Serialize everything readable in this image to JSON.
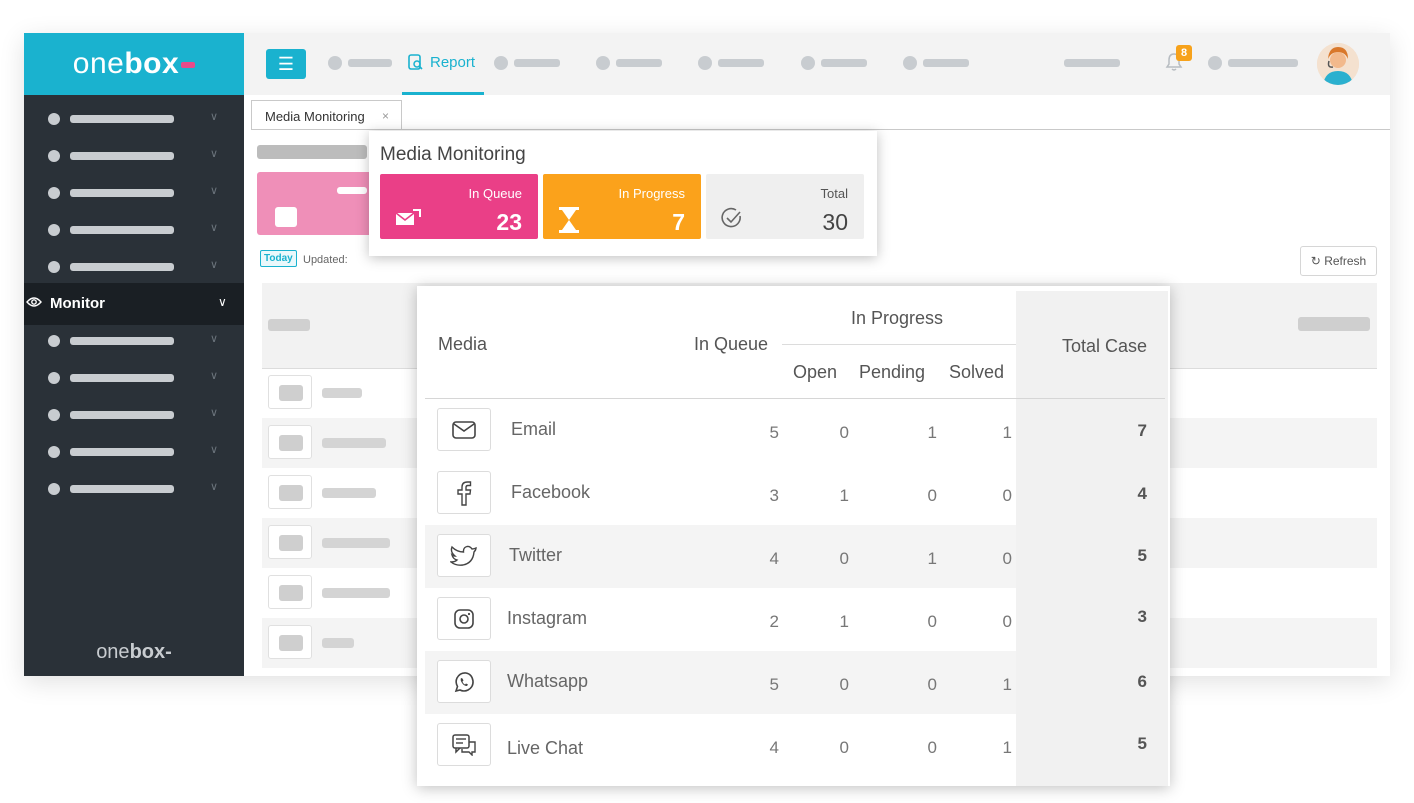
{
  "logo": {
    "pre": "one",
    "bold": "box"
  },
  "sidebar": {
    "active_label": "Monitor",
    "footer_pre": "one",
    "footer_bold": "box"
  },
  "topbar": {
    "report_label": "Report",
    "notification_count": "8"
  },
  "content": {
    "doc_tab_label": "Media Monitoring",
    "doc_tab_close": "×",
    "today_badge": "Today",
    "updated_label": "Updated:",
    "refresh_label": "Refresh"
  },
  "summary": {
    "title": "Media Monitoring",
    "in_queue": {
      "label": "In Queue",
      "value": "23"
    },
    "in_progress": {
      "label": "In Progress",
      "value": "7"
    },
    "total": {
      "label": "Total",
      "value": "30"
    }
  },
  "media_table": {
    "headers": {
      "media": "Media",
      "in_queue": "In Queue",
      "in_progress": "In Progress",
      "open": "Open",
      "pending": "Pending",
      "solved": "Solved",
      "total_case": "Total Case"
    },
    "rows": [
      {
        "icon": "email-icon",
        "media": "Email",
        "in_queue": "5",
        "open": "0",
        "pending": "1",
        "solved": "1",
        "total": "7"
      },
      {
        "icon": "facebook-icon",
        "media": "Facebook",
        "in_queue": "3",
        "open": "1",
        "pending": "0",
        "solved": "0",
        "total": "4"
      },
      {
        "icon": "twitter-icon",
        "media": "Twitter",
        "in_queue": "4",
        "open": "0",
        "pending": "1",
        "solved": "0",
        "total": "5"
      },
      {
        "icon": "instagram-icon",
        "media": "Instagram",
        "in_queue": "2",
        "open": "1",
        "pending": "0",
        "solved": "0",
        "total": "3"
      },
      {
        "icon": "whatsapp-icon",
        "media": "Whatsapp",
        "in_queue": "5",
        "open": "0",
        "pending": "0",
        "solved": "1",
        "total": "6"
      },
      {
        "icon": "live-chat-icon",
        "media": "Live Chat",
        "in_queue": "4",
        "open": "0",
        "pending": "0",
        "solved": "1",
        "total": "5"
      }
    ]
  },
  "colors": {
    "brand": "#1ab2cf",
    "sidebar": "#2a3138",
    "accent": "#f7a21b",
    "queue": "#ea3f87",
    "progress": "#fba21b"
  }
}
